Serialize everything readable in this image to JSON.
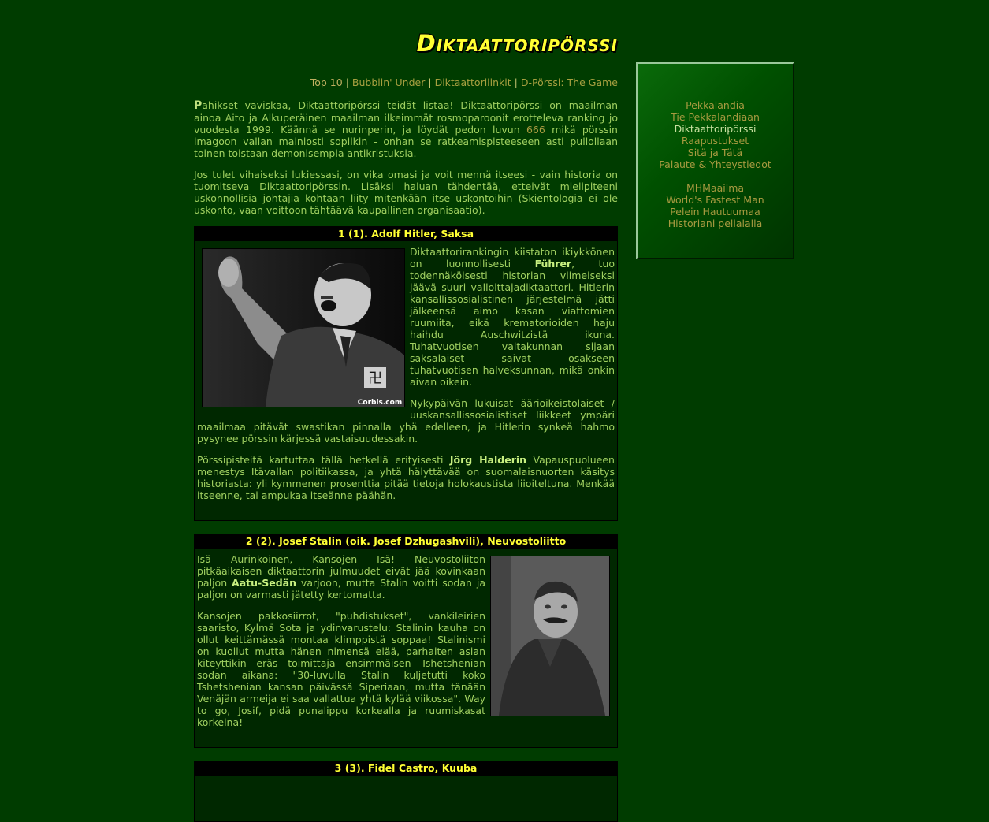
{
  "logo": "Diktaattoripörssi",
  "topnav": [
    {
      "label": "Top 10"
    },
    {
      "label": "Bubblin' Under"
    },
    {
      "label": "Diktaattorilinkit"
    },
    {
      "label": "D-Pörssi: The Game"
    }
  ],
  "intro": {
    "p1_cap": "P",
    "p1_a": "ahikset vaviskaa, Diktaattoripörssi teidät listaa! Diktaattoripörssi on maailman ainoa Aito ja Alkuperäinen maailman ilkeimmät rosmoparoonit erotteleva ranking jo vuodesta 1999. Käännä se nurinperin, ja löydät pedon luvun ",
    "p1_num": "666",
    "p1_b": " mikä pörssin imagoon vallan mainiosti sopiikin - onhan se ratkeamispisteeseen asti pullollaan toinen toistaan demonisempia antikristuksia.",
    "p2": "Jos tulet vihaiseksi lukiessasi, on vika omasi ja voit mennä itseesi - vain historia on tuomitseva Diktaattoripörssin. Lisäksi haluan tähdentää, etteivät mielipiteeni uskonnollisia johtajia kohtaan liity mitenkään itse uskontoihin (Skientologia ei ole uskonto, vaan voittoon tähtäävä kaupallinen organisaatio)."
  },
  "entries": [
    {
      "title": "1 (1). Adolf Hitler, Saksa",
      "p1_a": "Diktaattorirankingin kiistaton ikiykkönen on luonnollisesti ",
      "p1_name": "Führer",
      "p1_b": ", tuo todennäköisesti historian viimeiseksi jäävä suuri valloittajadiktaattori. Hitlerin kansallissosialistinen järjestelmä jätti jälkeensä aimo kasan viattomien ruumiita, eikä krematorioiden haju haihdu Auschwitzistä ikuna. Tuhatvuotisen valtakunnan sijaan saksalaiset saivat osakseen tuhatvuotisen halveksunnan, mikä onkin aivan oikein.",
      "p2": "Nykypäivän lukuisat äärioikeistolaiset / uuskansallissosialistiset liikkeet ympäri maailmaa pitävät swastikan pinnalla yhä edelleen, ja Hitlerin synkeä hahmo pysynee pörssin kärjessä vastaisuudessakin.",
      "p3_a": "Pörssipisteitä kartuttaa tällä hetkellä erityisesti ",
      "p3_name": "Jörg Halderin",
      "p3_b": " Vapauspuolueen menestys Itävallan politiikassa, ja yhtä hälyttävää on suomalaisnuorten käsitys historiasta: yli kymmenen prosenttia pitää tietoja holokaustista liioiteltuna. Menkää itseenne, tai ampukaa itseänne päähän.",
      "photo_credit": "Corbis.com"
    },
    {
      "title": "2 (2). Josef Stalin (oik. Josef Dzhugashvili), Neuvostoliitto",
      "p1_a": "Isä Aurinkoinen, Kansojen Isä! Neuvostoliiton pitkäaikaisen diktaattorin julmuudet eivät jää kovinkaan paljon ",
      "p1_name": "Aatu-Sedän",
      "p1_b": " varjoon, mutta Stalin voitti sodan ja paljon on varmasti jätetty kertomatta.",
      "p2": "Kansojen pakkosiirrot, \"puhdistukset\", vankileirien saaristo, Kylmä Sota ja ydinvarustelu: Stalinin kauha on ollut keittämässä montaa klimppistä soppaa! Stalinismi on kuollut mutta hänen nimensä elää, parhaiten asian kiteyttikin eräs toimittaja ensimmäisen Tshetshenian sodan aikana: \"30-luvulla Stalin kuljetutti koko Tshetshenian kansan päivässä Siperiaan, mutta tänään Venäjän armeija ei saa vallattua yhtä kylää viikossa\". Way to go, Josif, pidä punalippu korkealla ja ruumiskasat korkeina!"
    },
    {
      "title": "3 (3). Fidel Castro, Kuuba"
    }
  ],
  "sidebar": {
    "group1": [
      "Pekkalandia",
      "Tie Pekkalandiaan",
      "Diktaattoripörssi",
      "Raapustukset",
      "Sitä ja Tätä",
      "Palaute & Yhteystiedot"
    ],
    "group2": [
      "MHMaailma",
      "World's Fastest Man",
      "Pelein Hautuumaa",
      "Historiani pelialalla"
    ]
  },
  "colors": {
    "background": "#003c00",
    "text": "#a0d060",
    "title": "#ffff33",
    "link": "#a89a40"
  }
}
